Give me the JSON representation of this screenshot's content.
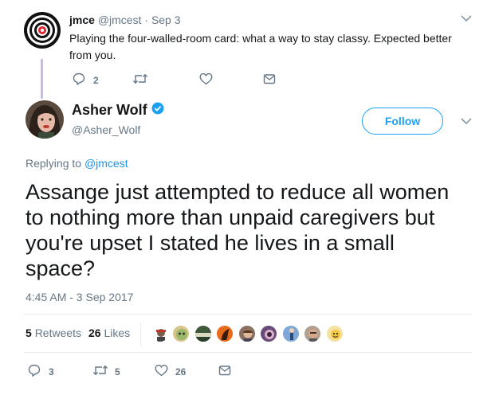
{
  "parent_tweet": {
    "display_name": "jmce",
    "handle": "@jmcest",
    "separator": "·",
    "date": "Sep 3",
    "text_line1": "Playing the four-walled-room card: what a way to stay classy. Expected better",
    "text_line2": "from you.",
    "reply_count": "2",
    "icons": [
      "reply-icon",
      "retweet-icon",
      "like-icon",
      "message-icon",
      "chevron-down-icon"
    ]
  },
  "main_tweet": {
    "display_name": "Asher Wolf",
    "handle": "@Asher_Wolf",
    "follow_label": "Follow",
    "replying_prefix": "Replying to",
    "replying_to": "@jmcest",
    "text_lines": [
      "Assange just attempted to reduce all women",
      "to nothing more than unpaid caregivers but",
      "you're upset I stated he lives in a small",
      "space?"
    ],
    "timestamp": "4:45 AM - 3 Sep 2017",
    "retweets_count": "5",
    "retweets_label": "Retweets",
    "likes_count": "26",
    "likes_label": "Likes",
    "actions": {
      "reply_count": "3",
      "retweet_count": "5",
      "like_count": "26"
    }
  },
  "colors": {
    "accent": "#1da1f2",
    "link": "#1b95e0",
    "thread_line": "#ccb7e6",
    "verified": "#1da1f2"
  }
}
